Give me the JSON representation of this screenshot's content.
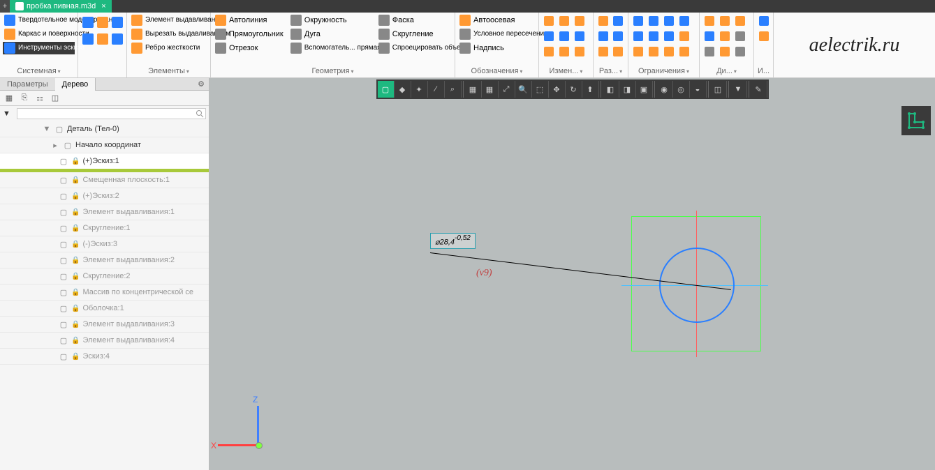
{
  "tab": {
    "title": "пробка пивная.m3d"
  },
  "ribbon": {
    "groups": {
      "g1": {
        "items": [
          "Твердотельное моделирование",
          "Каркас и поверхности",
          "Инструменты эскиза"
        ],
        "label": "Системная"
      },
      "g2": {
        "label": "Элементы",
        "items": [
          "Элемент выдавливания",
          "Вырезать выдавливанием",
          "Ребро жесткости"
        ]
      },
      "g3": {
        "label": "Геометрия",
        "items": [
          "Автолиния",
          "Прямоугольник",
          "Отрезок",
          "Окружность",
          "Дуга",
          "Вспомогатель... прямая",
          "Фаска",
          "Скругление",
          "Спроецировать объект"
        ]
      },
      "g4": {
        "label": "Обозначения",
        "items": [
          "Автоосевая",
          "Условное пересечение",
          "Надпись"
        ]
      },
      "g5": {
        "label": "Измен..."
      },
      "g6": {
        "label": "Раз..."
      },
      "g7": {
        "label": "Ограничения"
      },
      "g8": {
        "label": "Ди..."
      },
      "g9": {
        "label": "И..."
      }
    }
  },
  "leftpanel": {
    "tabs": {
      "params": "Параметры",
      "tree": "Дерево"
    },
    "search_placeholder": "",
    "tree": [
      {
        "indent": 50,
        "caret": "▼",
        "icon": "detail",
        "name": "Деталь (Тел-0)"
      },
      {
        "indent": 62,
        "caret": "▸",
        "icon": "origin",
        "name": "Начало координат"
      },
      {
        "indent": 74,
        "icon": "sketch",
        "lock": true,
        "dim": true,
        "name": "(+)Эскиз:1",
        "active": true
      },
      {
        "indent": 74,
        "icon": "plane",
        "lock": true,
        "name": "Смещенная плоскость:1",
        "dimmed": true
      },
      {
        "indent": 74,
        "icon": "sketch",
        "lock": true,
        "dim": true,
        "name": "(+)Эскиз:2",
        "dimmed": true
      },
      {
        "indent": 74,
        "icon": "extrude",
        "lock": true,
        "name": "Элемент выдавливания:1",
        "dimmed": true
      },
      {
        "indent": 74,
        "icon": "fillet",
        "lock": true,
        "name": "Скругление:1",
        "dimmed": true
      },
      {
        "indent": 74,
        "icon": "sketch",
        "lock": true,
        "dim": true,
        "name": "(-)Эскиз:3",
        "dimmed": true
      },
      {
        "indent": 74,
        "icon": "extrude",
        "lock": true,
        "name": "Элемент выдавливания:2",
        "dimmed": true
      },
      {
        "indent": 74,
        "icon": "fillet",
        "lock": true,
        "name": "Скругление:2",
        "dimmed": true
      },
      {
        "indent": 74,
        "icon": "array",
        "lock": true,
        "name": "Массив по концентрической се",
        "dimmed": true
      },
      {
        "indent": 74,
        "icon": "shell",
        "lock": true,
        "name": "Оболочка:1",
        "dimmed": true
      },
      {
        "indent": 74,
        "icon": "extrude",
        "lock": true,
        "name": "Элемент выдавливания:3",
        "dimmed": true
      },
      {
        "indent": 74,
        "icon": "extrude",
        "lock": true,
        "name": "Элемент выдавливания:4",
        "dimmed": true
      },
      {
        "indent": 74,
        "icon": "sketch",
        "lock": true,
        "name": "Эскиз:4",
        "dimmed": true
      }
    ]
  },
  "canvas": {
    "dimension": {
      "value": "⌀28,4",
      "tol": "-0,52"
    },
    "var": "(v9)"
  },
  "watermark": "aelectrik.ru"
}
